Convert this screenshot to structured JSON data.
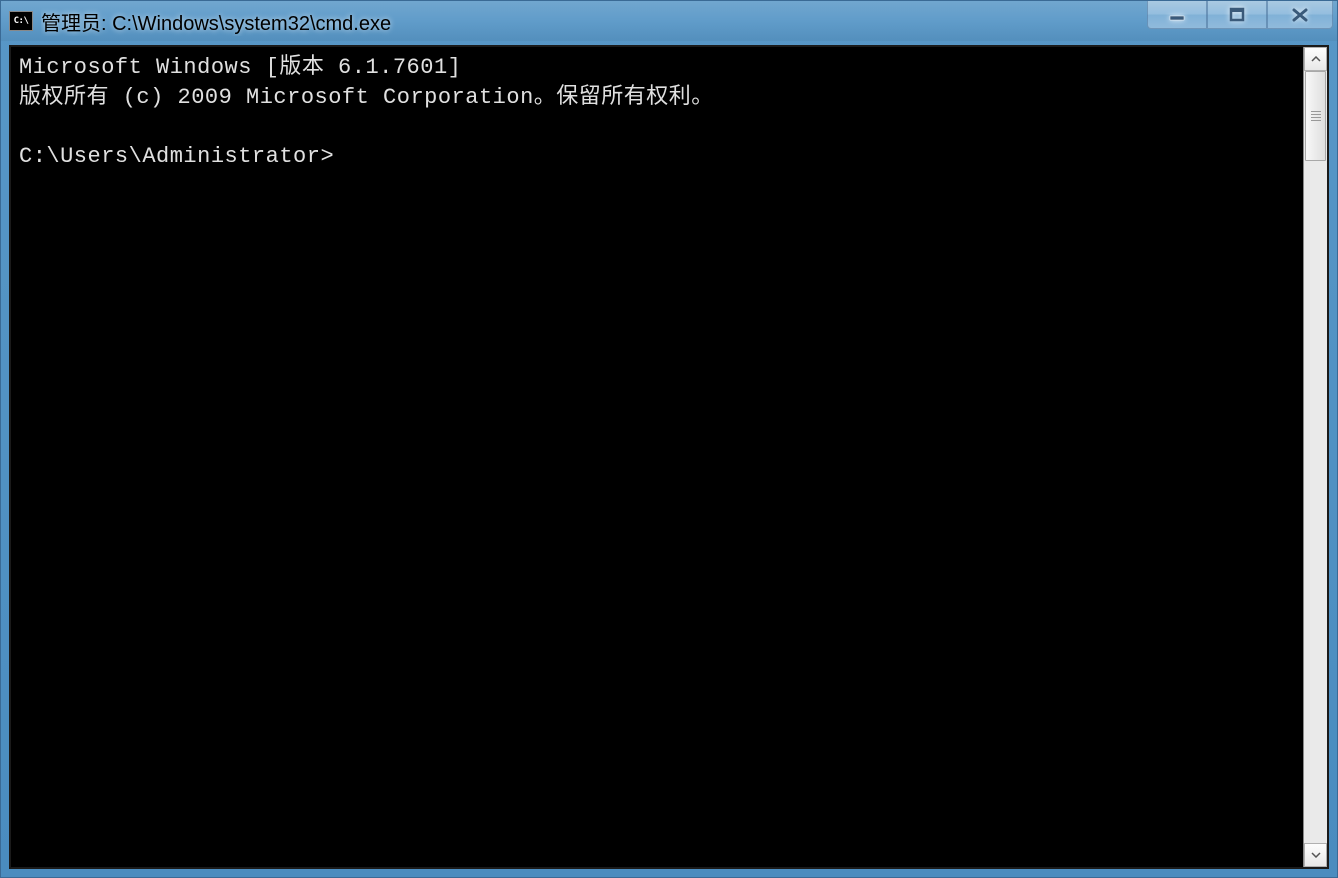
{
  "window": {
    "icon_label": "C:\\",
    "title": "管理员: C:\\Windows\\system32\\cmd.exe"
  },
  "controls": {
    "minimize_label": "minimize",
    "maximize_label": "maximize",
    "close_label": "close"
  },
  "console": {
    "line1": "Microsoft Windows [版本 6.1.7601]",
    "line2": "版权所有 (c) 2009 Microsoft Corporation。保留所有权利。",
    "blank": "",
    "prompt": "C:\\Users\\Administrator>"
  },
  "scrollbar": {
    "up": "▲",
    "down": "▼"
  }
}
